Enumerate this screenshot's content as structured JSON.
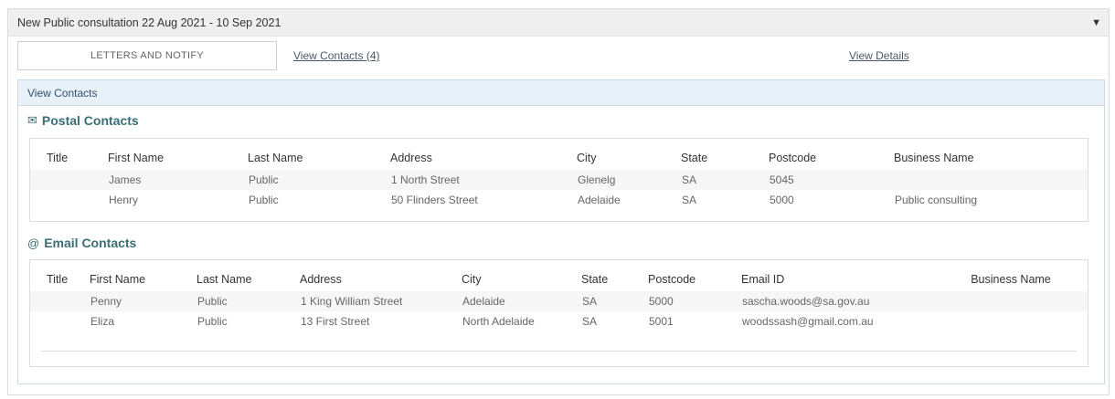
{
  "panel": {
    "title": "New Public consultation 22 Aug 2021 - 10 Sep 2021",
    "collapse_icon": "chevron-down-icon"
  },
  "tabs": {
    "letters": "LETTERS AND NOTIFY",
    "contacts": "View Contacts (4)",
    "details": "View Details"
  },
  "contacts_header": "View Contacts",
  "postal": {
    "title": "Postal Contacts",
    "icon": "envelope-icon",
    "columns": [
      "Title",
      "First Name",
      "Last Name",
      "Address",
      "City",
      "State",
      "Postcode",
      "Business Name"
    ],
    "rows": [
      [
        "",
        "James",
        "Public",
        "1 North Street",
        "Glenelg",
        "SA",
        "5045",
        ""
      ],
      [
        "",
        "Henry",
        "Public",
        "50 Flinders Street",
        "Adelaide",
        "SA",
        "5000",
        "Public consulting"
      ]
    ]
  },
  "email": {
    "title": "Email Contacts",
    "icon": "at-icon",
    "columns": [
      "Title",
      "First Name",
      "Last Name",
      "Address",
      "City",
      "State",
      "Postcode",
      "Email ID",
      "Business Name"
    ],
    "rows": [
      [
        "",
        "Penny",
        "Public",
        "1 King William Street",
        "Adelaide",
        "SA",
        "5000",
        "sascha.woods@sa.gov.au",
        ""
      ],
      [
        "",
        "Eliza",
        "Public",
        "13 First Street",
        "North Adelaide",
        "SA",
        "5001",
        "woodssash@gmail.com.au",
        ""
      ]
    ]
  }
}
